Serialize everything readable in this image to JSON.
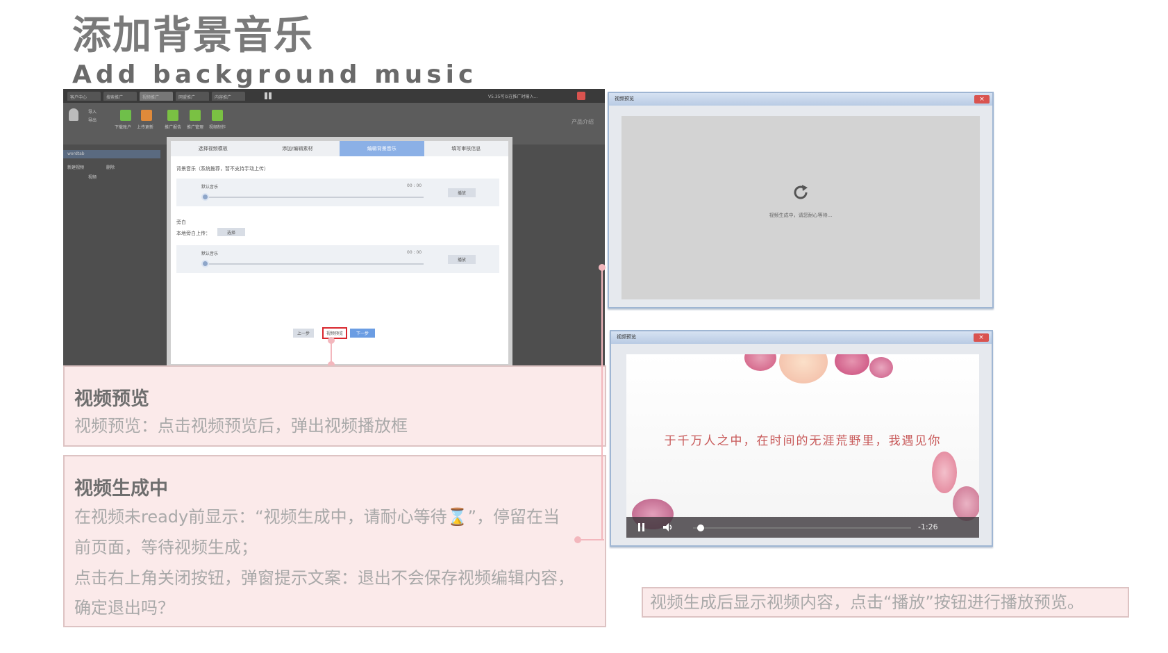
{
  "header": {
    "title_cn": "添加背景音乐",
    "title_en": "Add background music"
  },
  "app": {
    "tabs": [
      "客户中心",
      "搜索推广",
      "视频推广",
      "网盟推广",
      "内容推广"
    ],
    "toolbar": [
      "下载账户",
      "上传更新",
      "推广报告",
      "推广管理",
      "视频制作"
    ],
    "toolbar_side": [
      "导入",
      "导出"
    ],
    "right_label": "产品介绍",
    "left_rows": [
      "wordtab",
      "新建视频",
      "删除",
      "视频"
    ],
    "account_line": "V5.35可以在推广时输入..."
  },
  "dialog": {
    "steps": [
      "选择视频模板",
      "添加/编辑素材",
      "编辑背景音乐",
      "填写审核信息"
    ],
    "bg_music_label": "背景音乐（系统推荐，暂不支持手动上传）",
    "track1": {
      "name": "默认音乐",
      "time": "00 : 00",
      "play": "播放",
      "progress": 0
    },
    "narration_label": "旁白",
    "local_upload_label": "本地旁白上传：",
    "choose_button": "选择",
    "track2": {
      "name": "默认音乐",
      "time": "00 : 00",
      "play": "播放",
      "progress": 0
    },
    "prev_button": "上一步",
    "preview_button": "视频预览",
    "next_button": "下一步"
  },
  "info1": {
    "heading": "视频预览",
    "body": "视频预览：点击视频预览后，弹出视频播放框"
  },
  "info2": {
    "heading": "视频生成中",
    "line1": "在视频未ready前显示：“视频生成中，请耐心等待⌛”，停留在当",
    "line2": "前页面，等待视频生成；",
    "line3": "点击右上角关闭按钮，弹窗提示文案：退出不会保存视频编辑内容，",
    "line4": "确定退出吗？"
  },
  "preview_window_1": {
    "title": "视频预览",
    "close": "×",
    "loading_text": "视频生成中，请您耐心等待..."
  },
  "preview_window_2": {
    "title": "视频预览",
    "close": "×",
    "lyric": "于千万人之中，在时间的无涯荒野里，我遇见你",
    "time_remaining": "-1:26",
    "progress": 0.02
  },
  "caption": "视频生成后显示视频内容，点击“播放”按钮进行播放预览。",
  "colors": {
    "pink_bg": "#fbeaea",
    "pink_border": "#ddc3c3",
    "connector": "#f3b7bd",
    "active_step": "#8bb0e6",
    "preview_highlight": "#d9272e"
  }
}
